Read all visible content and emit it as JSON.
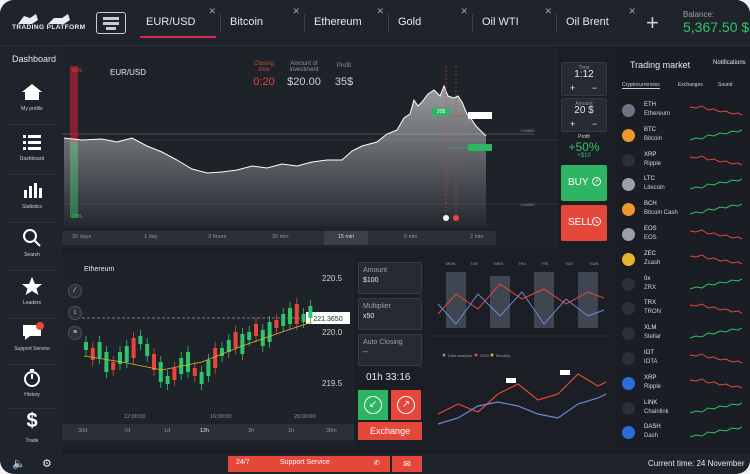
{
  "app": {
    "logo_text": "TRADING PLATFORM"
  },
  "tabs": [
    {
      "label": "EUR/USD",
      "active": true
    },
    {
      "label": "Bitcoin"
    },
    {
      "label": "Ethereum"
    },
    {
      "label": "Gold"
    },
    {
      "label": "Oil WTI"
    },
    {
      "label": "Oil Brent"
    }
  ],
  "balance": {
    "label": "Balance:",
    "value": "5,367.50 $"
  },
  "sidebar": {
    "title": "Dashboard",
    "items": [
      {
        "label": "My profile",
        "icon": "home-icon"
      },
      {
        "label": "Dashboard",
        "icon": "list-icon"
      },
      {
        "label": "Statistics",
        "icon": "bar-chart-icon"
      },
      {
        "label": "Search",
        "icon": "search-icon"
      },
      {
        "label": "Leaders",
        "icon": "star-icon"
      },
      {
        "label": "Support Service",
        "icon": "chat-icon",
        "badge": "1"
      },
      {
        "label": "History",
        "icon": "stopwatch-icon"
      },
      {
        "label": "Trade",
        "icon": "dollar-icon"
      }
    ]
  },
  "main_chart": {
    "pair": "EUR/USD",
    "closing_time_label": "Closing time",
    "closing_time": "0:20",
    "amount_label": "Amount of investment",
    "amount": "$20.00",
    "profit_label": "Profit",
    "profit": "35$",
    "pct_top": "60%",
    "pct_bottom": "29%",
    "marker_value": "20$",
    "price_labels": [
      "1.08600",
      "1.08500",
      "1.08400",
      "1.08300"
    ],
    "timeframes": [
      "30 days",
      "1 day",
      "3 hours",
      "30 min",
      "15 min",
      "5 min",
      "2 min"
    ],
    "selected_timeframe": "15 min"
  },
  "controls": {
    "time_label": "Time",
    "time_value": "1:12",
    "amount_label": "Amount",
    "amount_value": "20 $",
    "payout_label": "Profit",
    "payout_value": "+50%",
    "payout_sub": "+$10",
    "buy_label": "BUY",
    "sell_label": "SELL"
  },
  "market": {
    "title": "Trading market",
    "notifications": "Notifications",
    "tabs": [
      "Cryptocurrencies",
      "Exchanges",
      "Sound"
    ],
    "rows": [
      {
        "sym": "ETH",
        "name": "Ethereum",
        "color": "#6c7486",
        "trend": "down"
      },
      {
        "sym": "BTC",
        "name": "Bitcoin",
        "color": "#f0962f",
        "trend": "up"
      },
      {
        "sym": "XRP",
        "name": "Ripple",
        "color": "#2a2f38",
        "trend": "down"
      },
      {
        "sym": "LTC",
        "name": "Litecoin",
        "color": "#9aa0ad",
        "trend": "up"
      },
      {
        "sym": "BCH",
        "name": "Bitcoin Cash",
        "color": "#f0962f",
        "trend": "up"
      },
      {
        "sym": "EOS",
        "name": "EOS",
        "color": "#9aa0ad",
        "trend": "down"
      },
      {
        "sym": "ZEC",
        "name": "Zcash",
        "color": "#e6b32c",
        "trend": "down"
      },
      {
        "sym": "0x",
        "name": "ZRX",
        "color": "#2a2f38",
        "trend": "up"
      },
      {
        "sym": "TRX",
        "name": "TRON",
        "color": "#2a2f38",
        "trend": "down"
      },
      {
        "sym": "XLM",
        "name": "Stellar",
        "color": "#2a2f38",
        "trend": "up"
      },
      {
        "sym": "IOT",
        "name": "IOTA",
        "color": "#2a2f38",
        "trend": "down"
      },
      {
        "sym": "XRP",
        "name": "Ripple",
        "color": "#2a6fd6",
        "trend": "down"
      },
      {
        "sym": "LINK",
        "name": "Chainlink",
        "color": "#2a2f38",
        "trend": "up"
      },
      {
        "sym": "DASH",
        "name": "Dash",
        "color": "#2a6fd6",
        "trend": "up"
      }
    ]
  },
  "candle_chart": {
    "pair": "Ethereum",
    "current_price": "221.3650",
    "price_labels": [
      "220.5",
      "220.0",
      "219.5"
    ],
    "time_labels": [
      "12:00:00",
      "16:00:00",
      "20:00:00"
    ],
    "timeframes": [
      "30d",
      "7d",
      "1d",
      "12h",
      "3h",
      "1h",
      "30m"
    ],
    "selected_timeframe": "12h"
  },
  "order": {
    "amount_label": "Amount",
    "amount_value": "$100",
    "multiplier_label": "Multiplier",
    "multiplier_value": "x50",
    "autoclose_label": "Auto Closing",
    "autoclose_value": "--",
    "timer": "01h 33:16",
    "exchange_label": "Exchange"
  },
  "mini_charts": {
    "weekdays": [
      "MON",
      "TUE",
      "WED",
      "THU",
      "FRI",
      "SAT",
      "SUN"
    ],
    "legend": [
      "Data analysis",
      "2019",
      "Monthly"
    ]
  },
  "bottom": {
    "support_prefix": "24/7",
    "support_label": "Support Service",
    "current_time": "Current time: 24 November"
  }
}
